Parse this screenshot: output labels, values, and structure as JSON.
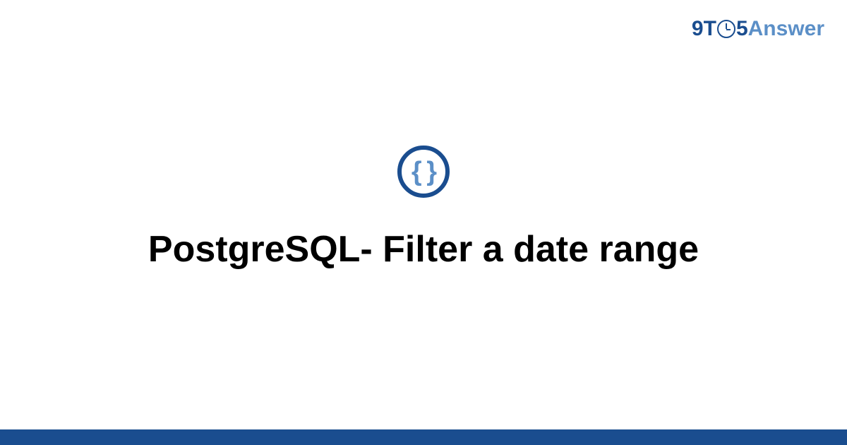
{
  "logo": {
    "prefix": "9T",
    "suffix": "5",
    "word": "Answer"
  },
  "badge": {
    "symbol": "{ }"
  },
  "title": "PostgreSQL- Filter a date range",
  "colors": {
    "primary": "#1a4d8f",
    "secondary": "#5b8fc7"
  }
}
